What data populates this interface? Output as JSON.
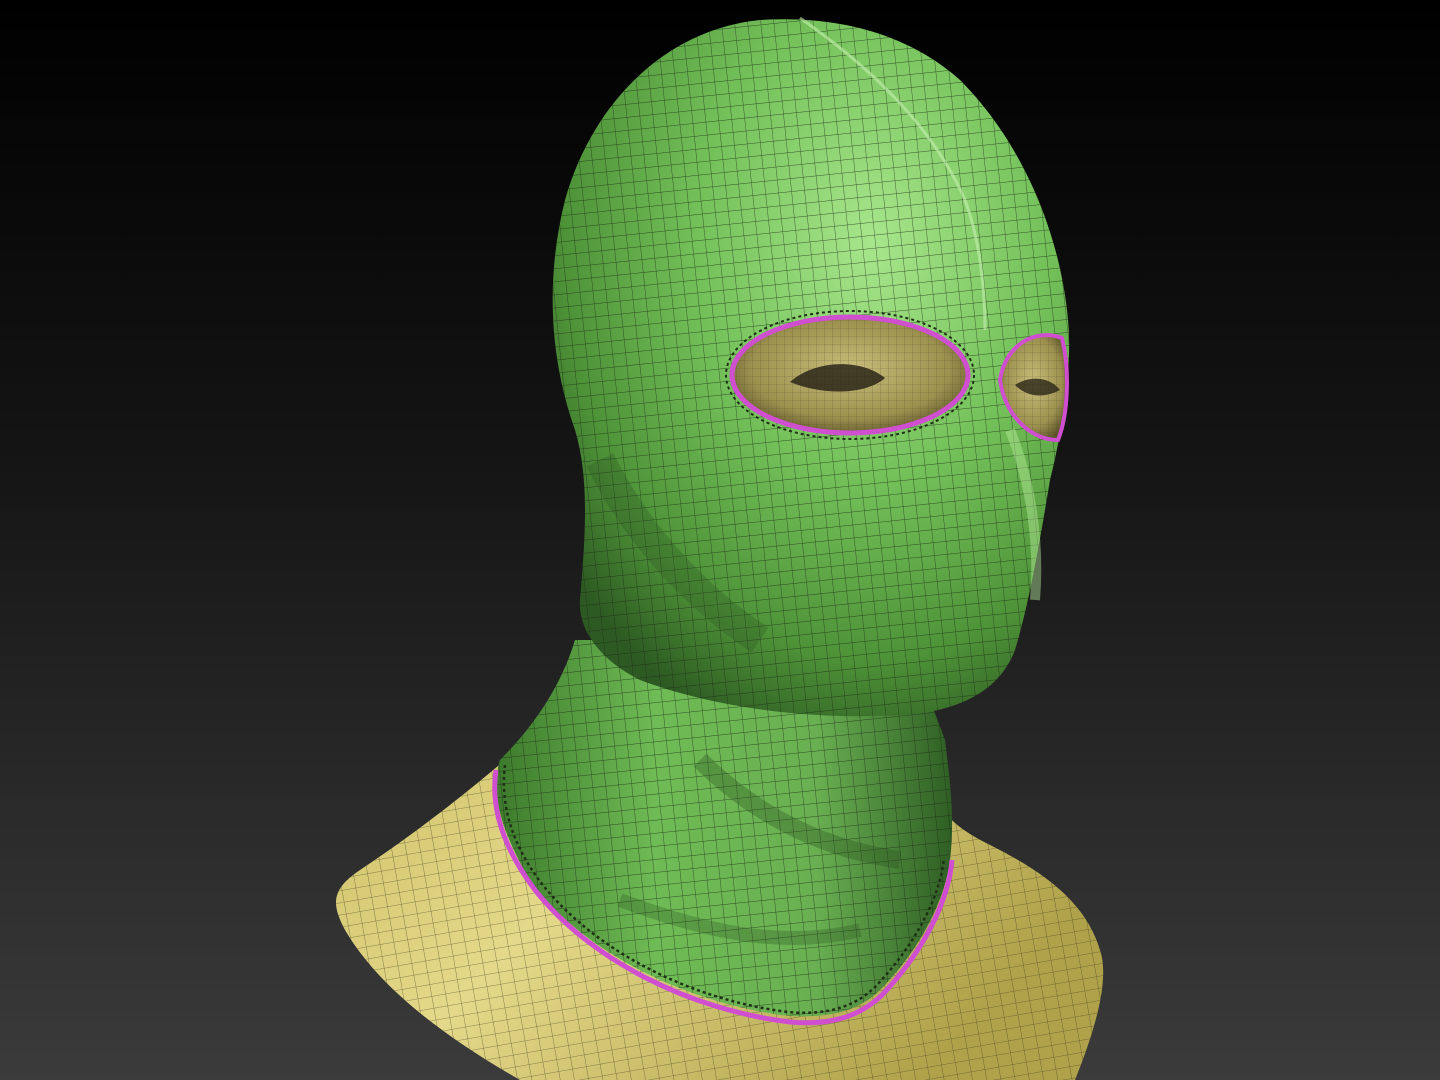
{
  "scene": {
    "background_top": "#000000",
    "background_bottom": "#3b3b3b",
    "colors": {
      "mask": "#79c65e",
      "mask_shadow": "#2f5a22",
      "bust": "#ddd27b",
      "bust_shadow": "#8f8438",
      "seam": "#d04fd0",
      "wire": "#1b2a14"
    },
    "icons": [
      "mask-icon"
    ]
  }
}
